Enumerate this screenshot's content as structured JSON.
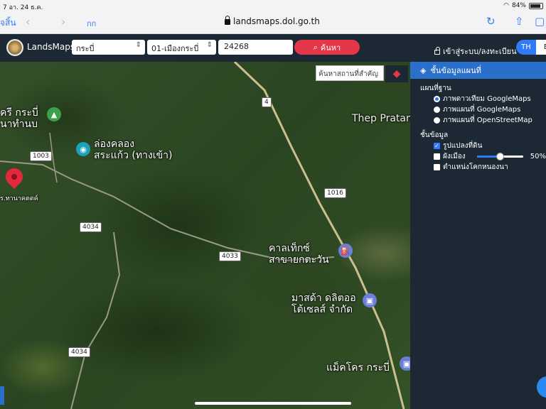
{
  "status": {
    "time": "7",
    "date": "อา. 24 ธ.ค.",
    "battery": "84%"
  },
  "safari": {
    "done": "จสิ้น",
    "aa": "กก",
    "url": "landsmaps.dol.go.th"
  },
  "header": {
    "brand": "LandsMaps",
    "province": "กระบี่",
    "district": "01-เมืองกระบี่",
    "parcel_no": "24268",
    "search_label": "ค้นหา",
    "login_label": "เข้าสู่ระบบ/ลงทะเบียน",
    "lang_th": "TH",
    "lang_en": "E"
  },
  "map": {
    "search_placeholder": "ค้นหาสถานที่สำคัญ",
    "labels": {
      "place1": "ครี กระบี่",
      "place1b": "นาทำนบ",
      "pond1": "ล่องคลอง",
      "pond2": "สระแก้ว (ทางเข้า)",
      "thep": "Thep Pratan",
      "caltex1": "คาลเท็กซ์",
      "caltex2": "สาขายกตะวัน",
      "mazda1": "มาสด้า ดลิตออ",
      "mazda2": "โต้เซลส์ จำกัด",
      "makro": "แม็คโคร กระบี่",
      "redpin": "ร.ทานาคตตค์"
    },
    "roads": {
      "r1": "4",
      "r1003": "1003",
      "r1016": "1016",
      "r4034a": "4034",
      "r4033": "4033",
      "r4034b": "4034"
    }
  },
  "panel": {
    "title": "ชั้นข้อมูลแผนที่",
    "base_title": "แผนที่ฐาน",
    "base_options": [
      "ภาพดาวเทียม GoogleMaps",
      "ภาพแผนที่ GoogleMaps",
      "ภาพแผนที่ OpenStreetMap"
    ],
    "base_selected": 0,
    "layer_title": "ชั้นข้อมูล",
    "layers": [
      "รูปแปลงที่ดิน",
      "ผังเมือง",
      "ตำแหน่งโคกหนองนา"
    ],
    "layers_checked": [
      true,
      false,
      false
    ],
    "opacity": 0.5,
    "opacity_label": "50%"
  }
}
